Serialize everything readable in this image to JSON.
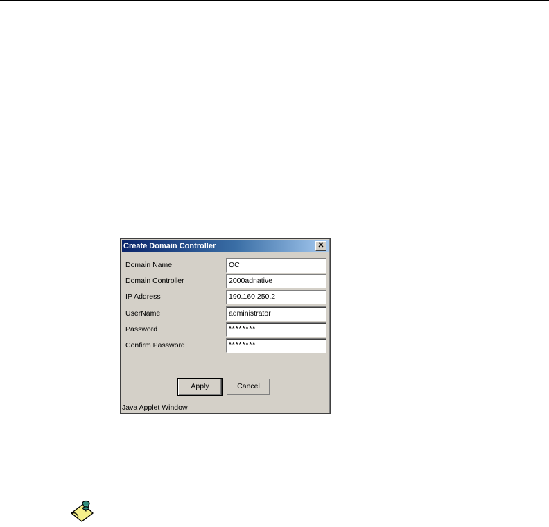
{
  "dialog": {
    "title": "Create Domain Controller",
    "close_glyph": "✕",
    "fields": [
      {
        "label": "Domain Name",
        "value": "QC"
      },
      {
        "label": "Domain Controller",
        "value": "2000adnative"
      },
      {
        "label": "IP Address",
        "value": "190.160.250.2"
      },
      {
        "label": "UserName",
        "value": "administrator"
      },
      {
        "label": "Password",
        "value": "********"
      },
      {
        "label": "Confirm Password",
        "value": "********"
      }
    ],
    "apply_label": "Apply",
    "cancel_label": "Cancel",
    "status": "Java Applet Window"
  },
  "icons": {
    "close": "close-icon",
    "note": "note-pin-icon"
  },
  "colors": {
    "dialog_bg": "#d4d0c8",
    "titlebar_start": "#0a246a",
    "titlebar_end": "#a6caf0",
    "note_paper": "#f6f08a",
    "note_pin": "#2f8a7a"
  }
}
